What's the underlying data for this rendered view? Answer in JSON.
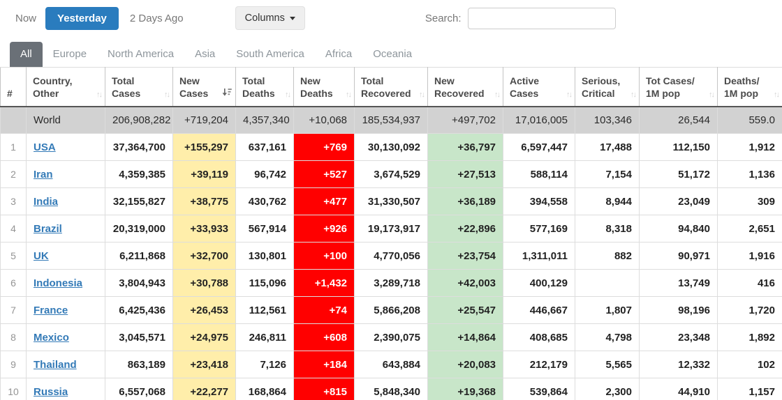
{
  "toolbar": {
    "now_label": "Now",
    "yesterday_label": "Yesterday",
    "two_days_ago_label": "2 Days Ago",
    "columns_label": "Columns",
    "search_label": "Search:",
    "search_value": ""
  },
  "tabs": [
    {
      "label": "All",
      "active": true
    },
    {
      "label": "Europe",
      "active": false
    },
    {
      "label": "North America",
      "active": false
    },
    {
      "label": "Asia",
      "active": false
    },
    {
      "label": "South America",
      "active": false
    },
    {
      "label": "Africa",
      "active": false
    },
    {
      "label": "Oceania",
      "active": false
    }
  ],
  "colors": {
    "accent_blue": "#2a7cbe",
    "active_tab_gray": "#6a7077",
    "new_cases_yellow": "#FFEEAA",
    "new_recovered_green": "#C8E6C9",
    "new_deaths_red": "#FF0000",
    "link_blue": "#337ab7",
    "world_row_gray": "#d2d2d2"
  },
  "table": {
    "columns": [
      {
        "line1": "#",
        "line2": "",
        "sort": "none"
      },
      {
        "line1": "Country,",
        "line2": "Other",
        "sort": "unsorted"
      },
      {
        "line1": "Total",
        "line2": "Cases",
        "sort": "unsorted"
      },
      {
        "line1": "New",
        "line2": "Cases",
        "sort": "desc"
      },
      {
        "line1": "Total",
        "line2": "Deaths",
        "sort": "unsorted"
      },
      {
        "line1": "New",
        "line2": "Deaths",
        "sort": "unsorted"
      },
      {
        "line1": "Total",
        "line2": "Recovered",
        "sort": "unsorted"
      },
      {
        "line1": "New",
        "line2": "Recovered",
        "sort": "unsorted"
      },
      {
        "line1": "Active",
        "line2": "Cases",
        "sort": "unsorted"
      },
      {
        "line1": "Serious,",
        "line2": "Critical",
        "sort": "unsorted"
      },
      {
        "line1": "Tot Cases/",
        "line2": "1M pop",
        "sort": "unsorted"
      },
      {
        "line1": "Deaths/",
        "line2": "1M pop",
        "sort": "unsorted"
      }
    ],
    "world_row": {
      "rank": "",
      "country": "World",
      "total_cases": "206,908,282",
      "new_cases": "+719,204",
      "total_deaths": "4,357,340",
      "new_deaths": "+10,068",
      "total_recovered": "185,534,937",
      "new_recovered": "+497,702",
      "active_cases": "17,016,005",
      "serious_critical": "103,346",
      "tot_cases_1m": "26,544",
      "deaths_1m": "559.0"
    },
    "rows": [
      {
        "rank": "1",
        "country": "USA",
        "total_cases": "37,364,700",
        "new_cases": "+155,297",
        "total_deaths": "637,161",
        "new_deaths": "+769",
        "total_recovered": "30,130,092",
        "new_recovered": "+36,797",
        "active_cases": "6,597,447",
        "serious_critical": "17,488",
        "tot_cases_1m": "112,150",
        "deaths_1m": "1,912"
      },
      {
        "rank": "2",
        "country": "Iran",
        "total_cases": "4,359,385",
        "new_cases": "+39,119",
        "total_deaths": "96,742",
        "new_deaths": "+527",
        "total_recovered": "3,674,529",
        "new_recovered": "+27,513",
        "active_cases": "588,114",
        "serious_critical": "7,154",
        "tot_cases_1m": "51,172",
        "deaths_1m": "1,136"
      },
      {
        "rank": "3",
        "country": "India",
        "total_cases": "32,155,827",
        "new_cases": "+38,775",
        "total_deaths": "430,762",
        "new_deaths": "+477",
        "total_recovered": "31,330,507",
        "new_recovered": "+36,189",
        "active_cases": "394,558",
        "serious_critical": "8,944",
        "tot_cases_1m": "23,049",
        "deaths_1m": "309"
      },
      {
        "rank": "4",
        "country": "Brazil",
        "total_cases": "20,319,000",
        "new_cases": "+33,933",
        "total_deaths": "567,914",
        "new_deaths": "+926",
        "total_recovered": "19,173,917",
        "new_recovered": "+22,896",
        "active_cases": "577,169",
        "serious_critical": "8,318",
        "tot_cases_1m": "94,840",
        "deaths_1m": "2,651"
      },
      {
        "rank": "5",
        "country": "UK",
        "total_cases": "6,211,868",
        "new_cases": "+32,700",
        "total_deaths": "130,801",
        "new_deaths": "+100",
        "total_recovered": "4,770,056",
        "new_recovered": "+23,754",
        "active_cases": "1,311,011",
        "serious_critical": "882",
        "tot_cases_1m": "90,971",
        "deaths_1m": "1,916"
      },
      {
        "rank": "6",
        "country": "Indonesia",
        "total_cases": "3,804,943",
        "new_cases": "+30,788",
        "total_deaths": "115,096",
        "new_deaths": "+1,432",
        "total_recovered": "3,289,718",
        "new_recovered": "+42,003",
        "active_cases": "400,129",
        "serious_critical": "",
        "tot_cases_1m": "13,749",
        "deaths_1m": "416"
      },
      {
        "rank": "7",
        "country": "France",
        "total_cases": "6,425,436",
        "new_cases": "+26,453",
        "total_deaths": "112,561",
        "new_deaths": "+74",
        "total_recovered": "5,866,208",
        "new_recovered": "+25,547",
        "active_cases": "446,667",
        "serious_critical": "1,807",
        "tot_cases_1m": "98,196",
        "deaths_1m": "1,720"
      },
      {
        "rank": "8",
        "country": "Mexico",
        "total_cases": "3,045,571",
        "new_cases": "+24,975",
        "total_deaths": "246,811",
        "new_deaths": "+608",
        "total_recovered": "2,390,075",
        "new_recovered": "+14,864",
        "active_cases": "408,685",
        "serious_critical": "4,798",
        "tot_cases_1m": "23,348",
        "deaths_1m": "1,892"
      },
      {
        "rank": "9",
        "country": "Thailand",
        "total_cases": "863,189",
        "new_cases": "+23,418",
        "total_deaths": "7,126",
        "new_deaths": "+184",
        "total_recovered": "643,884",
        "new_recovered": "+20,083",
        "active_cases": "212,179",
        "serious_critical": "5,565",
        "tot_cases_1m": "12,332",
        "deaths_1m": "102"
      },
      {
        "rank": "10",
        "country": "Russia",
        "total_cases": "6,557,068",
        "new_cases": "+22,277",
        "total_deaths": "168,864",
        "new_deaths": "+815",
        "total_recovered": "5,848,340",
        "new_recovered": "+19,368",
        "active_cases": "539,864",
        "serious_critical": "2,300",
        "tot_cases_1m": "44,910",
        "deaths_1m": "1,157"
      }
    ]
  }
}
